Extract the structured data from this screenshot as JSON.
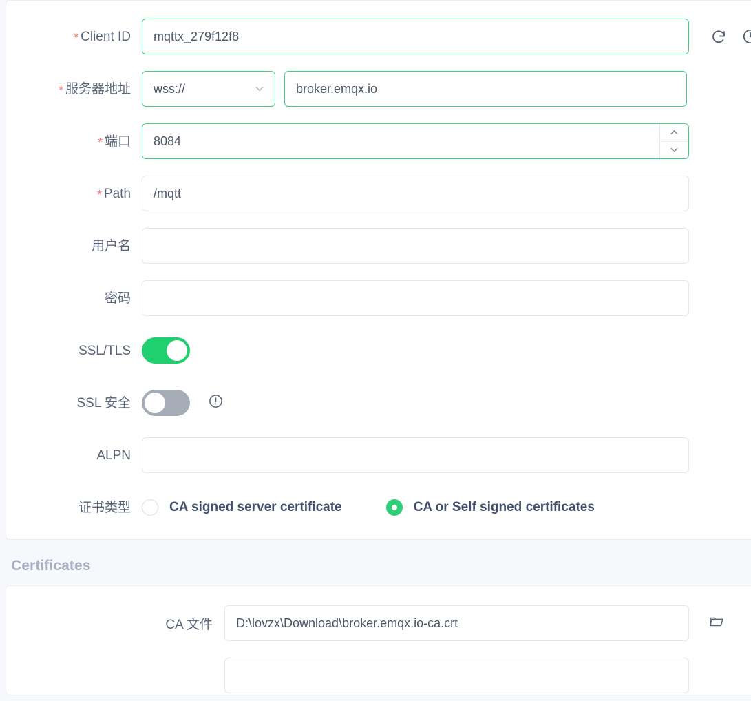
{
  "form": {
    "rows": [
      {
        "id": "client-id",
        "label": "Client ID",
        "required": true,
        "value": "mqttx_279f12f8",
        "placeholder": ""
      },
      {
        "id": "host",
        "label": "服务器地址",
        "required": true,
        "protocol": "wss://",
        "value": "broker.emqx.io",
        "placeholder": ""
      },
      {
        "id": "port",
        "label": "端口",
        "required": true,
        "value": "8084",
        "placeholder": ""
      },
      {
        "id": "path",
        "label": "Path",
        "required": true,
        "value": "/mqtt",
        "placeholder": ""
      },
      {
        "id": "username",
        "label": "用户名",
        "required": false,
        "value": "",
        "placeholder": ""
      },
      {
        "id": "password",
        "label": "密码",
        "required": false,
        "value": "",
        "placeholder": ""
      },
      {
        "id": "ssl-tls",
        "label": "SSL/TLS",
        "required": false,
        "toggle": "on"
      },
      {
        "id": "ssl-secure",
        "label": "SSL 安全",
        "required": false,
        "toggle": "off"
      },
      {
        "id": "alpn",
        "label": "ALPN",
        "required": false,
        "value": "",
        "placeholder": ""
      },
      {
        "id": "cert-type",
        "label": "证书类型",
        "required": false
      }
    ],
    "cert_type_options": [
      {
        "label": "CA signed server certificate",
        "checked": false
      },
      {
        "label": "CA or Self signed certificates",
        "checked": true
      }
    ]
  },
  "top_icons": {
    "refresh": "refresh-icon",
    "history": "clock-icon"
  },
  "certificates": {
    "title": "Certificates",
    "rows": [
      {
        "id": "ca-file",
        "label": "CA 文件",
        "value": "D:\\lovzx\\Download\\broker.emqx.io-ca.crt",
        "placeholder": "",
        "browse_icon": "folder-icon"
      }
    ]
  },
  "colors": {
    "accent_green": "#20cf6e",
    "valid_border": "#41cf86",
    "required_star": "#f3756e",
    "label_text": "#5b6579",
    "section_header": "#a7afc4",
    "page_bg": "#f7f8fc",
    "input_border": "#e6e7ee",
    "toggle_off": "#a6acb6"
  }
}
